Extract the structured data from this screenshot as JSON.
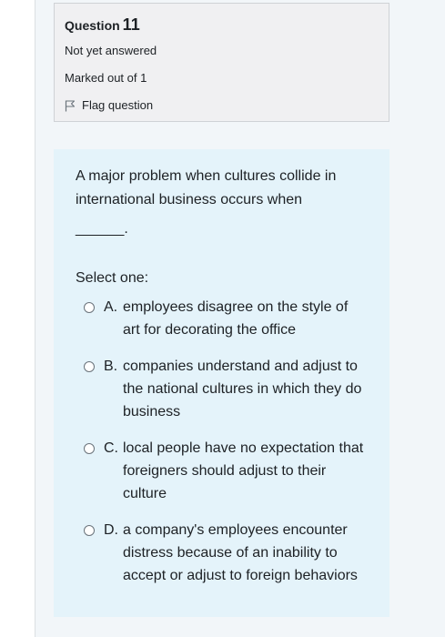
{
  "question": {
    "label": "Question",
    "number": "11",
    "state": "Not yet answered",
    "grade": "Marked out of 1",
    "flag_label": "Flag question"
  },
  "content": {
    "text": "A major problem when cultures collide in international business occurs when",
    "blank": "______.",
    "prompt": "Select one:",
    "options": [
      {
        "letter": "A.",
        "text": "employees disagree on the style of art for decorating the office"
      },
      {
        "letter": "B.",
        "text": "companies understand and adjust to the national cultures in which they do business"
      },
      {
        "letter": "C.",
        "text": "local people have no expectation that foreigners should adjust to their culture"
      },
      {
        "letter": "D.",
        "text": "a company's employees encounter distress because of an inability to accept or adjust to foreign behaviors"
      }
    ]
  },
  "colors": {
    "info_bg": "#f0f0f2",
    "content_bg": "#e4f3fa",
    "frame_bg": "#f2f6f9"
  },
  "icons": {
    "flag": "flag-outline-icon",
    "radio": "radio-unchecked"
  }
}
